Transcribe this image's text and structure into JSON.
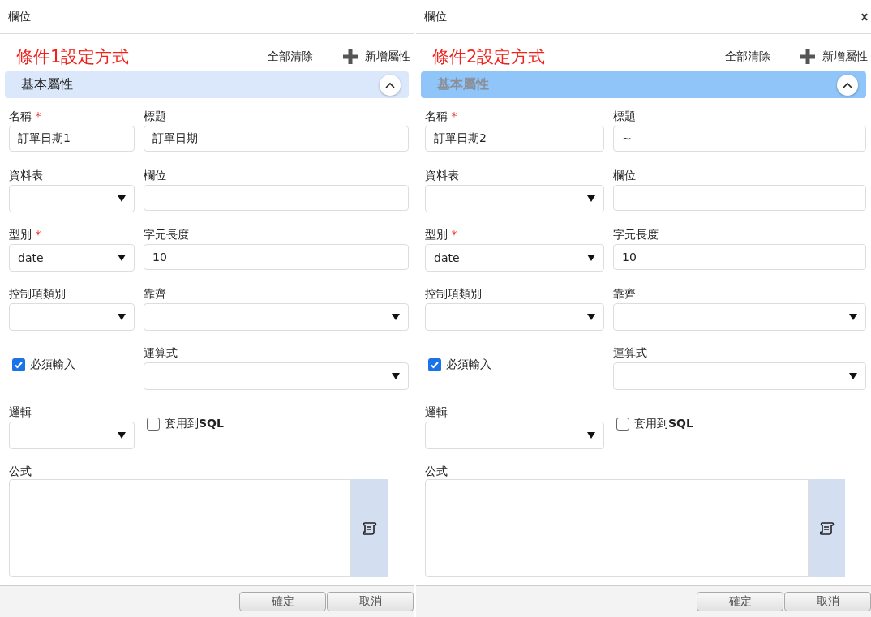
{
  "panels": [
    {
      "title": "欄位",
      "close_button": false,
      "heading": "條件1設定方式",
      "actions": [
        {
          "kind": "text",
          "label": "全部清除"
        },
        {
          "kind": "add",
          "label": "新增屬性"
        }
      ],
      "section": {
        "label": "基本屬性",
        "expanded": true,
        "highlighted": false
      },
      "fields": [
        {
          "kind": "input",
          "label": "名稱",
          "required_mark": "*",
          "value": "訂單日期1"
        },
        {
          "kind": "input",
          "label": "標題",
          "value": "訂單日期"
        },
        {
          "kind": "select",
          "label": "資料表"
        },
        {
          "kind": "input",
          "label": "欄位"
        },
        {
          "kind": "select",
          "label": "型別",
          "required_mark": "*",
          "value": "date"
        },
        {
          "kind": "input",
          "label": "字元長度",
          "value": "10"
        },
        {
          "kind": "select",
          "label": "控制項類別"
        },
        {
          "kind": "select",
          "label": "靠齊"
        },
        {
          "kind": "checkbox",
          "label": "必須輸入",
          "checked": true
        },
        {
          "kind": "select",
          "label": "運算式"
        },
        {
          "kind": "select",
          "label": "邏輯"
        },
        {
          "kind": "checkbox",
          "label": "套用到**SQL**",
          "checked": false
        },
        {
          "kind": "textarea",
          "label": "公式"
        }
      ],
      "buttons": [
        "確定",
        "取消"
      ]
    },
    {
      "title": "欄位",
      "close_button": true,
      "heading": "條件2設定方式",
      "actions": [
        {
          "kind": "text",
          "label": "全部清除"
        },
        {
          "kind": "add",
          "label": "新增屬性"
        }
      ],
      "section": {
        "label": "基本屬性",
        "expanded": true,
        "highlighted": true
      },
      "fields": [
        {
          "kind": "input",
          "label": "名稱",
          "required_mark": "*",
          "value": "訂單日期2"
        },
        {
          "kind": "input",
          "label": "標題",
          "value": "~"
        },
        {
          "kind": "select",
          "label": "資料表"
        },
        {
          "kind": "input",
          "label": "欄位"
        },
        {
          "kind": "select",
          "label": "型別",
          "required_mark": "*",
          "value": "date"
        },
        {
          "kind": "input",
          "label": "字元長度",
          "value": "10"
        },
        {
          "kind": "select",
          "label": "控制項類別"
        },
        {
          "kind": "select",
          "label": "靠齊"
        },
        {
          "kind": "checkbox",
          "label": "必須輸入",
          "checked": true
        },
        {
          "kind": "select",
          "label": "運算式"
        },
        {
          "kind": "select",
          "label": "邏輯"
        },
        {
          "kind": "checkbox",
          "label": "套用到**SQL**",
          "checked": false
        },
        {
          "kind": "textarea",
          "label": "公式"
        }
      ],
      "buttons": [
        "確定",
        "取消"
      ]
    }
  ]
}
